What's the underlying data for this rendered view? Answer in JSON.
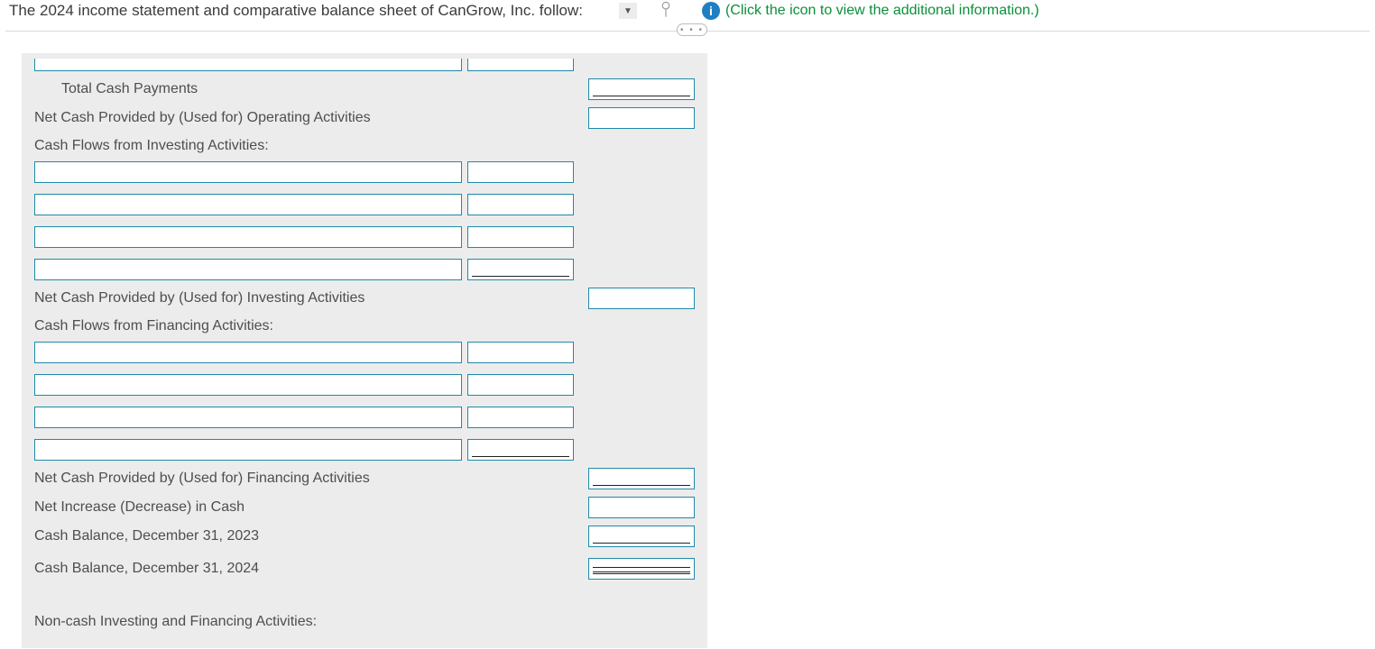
{
  "header": {
    "intro": "The 2024 income statement and comparative balance sheet of CanGrow, Inc. follow:",
    "info_link": "(Click the icon to view the additional information.)",
    "pill": "• • •"
  },
  "labels": {
    "total_cash_payments": "Total Cash Payments",
    "net_op": "Net Cash Provided by (Used for) Operating Activities",
    "inv_header": "Cash Flows from Investing Activities:",
    "net_inv": "Net Cash Provided by (Used for) Investing Activities",
    "fin_header": "Cash Flows from Financing Activities:",
    "net_fin": "Net Cash Provided by (Used for) Financing Activities",
    "net_change": "Net Increase (Decrease) in Cash",
    "cb_2023": "Cash Balance, December 31, 2023",
    "cb_2024": "Cash Balance, December 31, 2024",
    "noncash": "Non-cash Investing and Financing Activities:"
  }
}
